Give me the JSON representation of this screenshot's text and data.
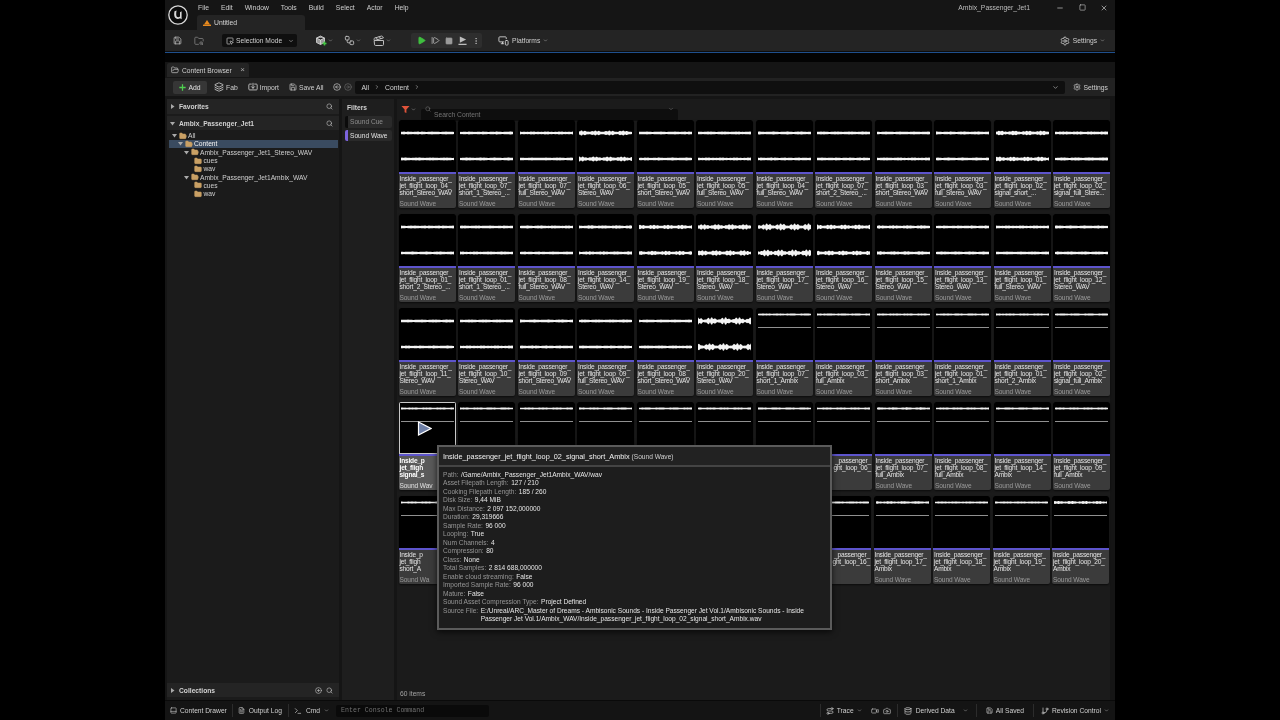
{
  "window": {
    "title": "Ambix_Passenger_Jet1",
    "document_tab": "Untitled"
  },
  "menu": [
    "File",
    "Edit",
    "Window",
    "Tools",
    "Build",
    "Select",
    "Actor",
    "Help"
  ],
  "toolbar": {
    "mode": "Selection Mode",
    "platforms": "Platforms",
    "settings": "Settings"
  },
  "content_browser": {
    "tab": {
      "label": "Content Browser",
      "close": "×"
    },
    "actions": {
      "add": "Add",
      "fab": "Fab",
      "import": "Import",
      "save_all": "Save All"
    },
    "breadcrumb": [
      "All",
      "Content"
    ],
    "settings": "Settings"
  },
  "sources": {
    "favorites": {
      "title": "Favorites",
      "expanded": false
    },
    "project": {
      "title": "Ambix_Passenger_Jet1",
      "expanded": true
    },
    "tree": [
      {
        "label": "All",
        "expanded": true,
        "selected": false,
        "children": [
          {
            "label": "Content",
            "expanded": true,
            "selected": true,
            "children": [
              {
                "label": "Ambix_Passenger_Jet1_Stereo_WAV",
                "expanded": true,
                "selected": false,
                "children": [
                  {
                    "label": "cues",
                    "selected": false
                  },
                  {
                    "label": "wav",
                    "selected": false
                  }
                ]
              },
              {
                "label": "Ambix_Passenger_Jet1Ambix_WAV",
                "expanded": true,
                "selected": false,
                "children": [
                  {
                    "label": "cues",
                    "selected": false
                  },
                  {
                    "label": "wav",
                    "selected": false
                  }
                ]
              }
            ]
          }
        ]
      }
    ],
    "collections": {
      "title": "Collections",
      "expanded": false
    }
  },
  "filters": {
    "title": "Filters",
    "items": [
      {
        "label": "Sound Cue",
        "checked": false
      },
      {
        "label": "Sound Wave",
        "checked": true
      }
    ]
  },
  "search": {
    "placeholder": "Search Content"
  },
  "asset_rows": [
    {
      "tiles": [
        {
          "kind": "stereo",
          "hovered": false,
          "name_lines": [
            "Inside_passenger_",
            "jet_flight_loop_04_",
            "short_Stereo_WAV"
          ],
          "type": "Sound Wave"
        },
        {
          "kind": "stereo",
          "hovered": false,
          "name_lines": [
            "Inside_passenger_",
            "jet_flight_loop_07_",
            "short_1_Stereo_..."
          ],
          "type": "Sound Wave"
        },
        {
          "kind": "stereo",
          "hovered": false,
          "name_lines": [
            "Inside_passenger_",
            "jet_flight_loop_07_",
            "full_Stereo_WAV"
          ],
          "type": "Sound Wave"
        },
        {
          "kind": "stereo",
          "hovered": false,
          "name_lines": [
            "Inside_passenger_",
            "jet_flight_loop_06_",
            "Stereo_WAV"
          ],
          "type": "Sound Wave"
        },
        {
          "kind": "stereo",
          "hovered": false,
          "name_lines": [
            "Inside_passenger_",
            "jet_flight_loop_05_",
            "short_Stereo_WAV"
          ],
          "type": "Sound Wave"
        },
        {
          "kind": "stereo",
          "hovered": false,
          "name_lines": [
            "Inside_passenger_",
            "jet_flight_loop_05_",
            "full_Stereo_WAV"
          ],
          "type": "Sound Wave"
        },
        {
          "kind": "stereo",
          "hovered": false,
          "name_lines": [
            "Inside_passenger_",
            "jet_flight_loop_04_",
            "full_Stereo_WAV"
          ],
          "type": "Sound Wave"
        },
        {
          "kind": "stereo",
          "hovered": false,
          "name_lines": [
            "Inside_passenger_",
            "jet_flight_loop_07_",
            "short_2_Stereo_..."
          ],
          "type": "Sound Wave"
        },
        {
          "kind": "stereo",
          "hovered": false,
          "name_lines": [
            "Inside_passenger_",
            "jet_flight_loop_03_",
            "short_Stereo_WAV"
          ],
          "type": "Sound Wave"
        },
        {
          "kind": "stereo",
          "hovered": false,
          "name_lines": [
            "Inside_passenger_",
            "jet_flight_loop_03_",
            "full_Stereo_WAV"
          ],
          "type": "Sound Wave"
        },
        {
          "kind": "stereo",
          "hovered": false,
          "name_lines": [
            "Inside_passenger_",
            "jet_flight_loop_02_",
            "signal_short_..."
          ],
          "type": "Sound Wave"
        },
        {
          "kind": "stereo",
          "hovered": false,
          "name_lines": [
            "Inside_passenger_",
            "jet_flight_loop_02_",
            "signal_full_Stere..."
          ],
          "type": "Sound Wave"
        }
      ]
    },
    {
      "tiles": [
        {
          "kind": "stereo",
          "hovered": false,
          "name_lines": [
            "Inside_passenger_",
            "jet_flight_loop_01_",
            "short_2_Stereo_..."
          ],
          "type": "Sound Wave"
        },
        {
          "kind": "stereo",
          "hovered": false,
          "name_lines": [
            "Inside_passenger_",
            "jet_flight_loop_01_",
            "short_1_Stereo_..."
          ],
          "type": "Sound Wave"
        },
        {
          "kind": "stereo",
          "hovered": false,
          "name_lines": [
            "Inside_passenger_",
            "jet_flight_loop_08_",
            "full_Stereo_WAV"
          ],
          "type": "Sound Wave"
        },
        {
          "kind": "stereo",
          "hovered": false,
          "name_lines": [
            "Inside_passenger_",
            "jet_flight_loop_14_",
            "Stereo_WAV"
          ],
          "type": "Sound Wave"
        },
        {
          "kind": "stereo",
          "hovered": false,
          "name_lines": [
            "Inside_passenger_",
            "jet_flight_loop_19_",
            "Stereo_WAV"
          ],
          "type": "Sound Wave"
        },
        {
          "kind": "stereo",
          "hovered": false,
          "name_lines": [
            "Inside_passenger_",
            "jet_flight_loop_18_",
            "Stereo_WAV"
          ],
          "type": "Sound Wave"
        },
        {
          "kind": "stereo",
          "hovered": false,
          "name_lines": [
            "Inside_passenger_",
            "jet_flight_loop_17_",
            "Stereo_WAV"
          ],
          "type": "Sound Wave"
        },
        {
          "kind": "stereo",
          "hovered": false,
          "name_lines": [
            "Inside_passenger_",
            "jet_flight_loop_16_",
            "Stereo_WAV"
          ],
          "type": "Sound Wave"
        },
        {
          "kind": "stereo",
          "hovered": false,
          "name_lines": [
            "Inside_passenger_",
            "jet_flight_loop_15_",
            "Stereo_WAV"
          ],
          "type": "Sound Wave"
        },
        {
          "kind": "stereo",
          "hovered": false,
          "name_lines": [
            "Inside_passenger_",
            "jet_flight_loop_13_",
            "Stereo_WAV"
          ],
          "type": "Sound Wave"
        },
        {
          "kind": "stereo",
          "hovered": false,
          "name_lines": [
            "Inside_passenger_",
            "jet_flight_loop_01_",
            "full_Stereo_WAV"
          ],
          "type": "Sound Wave"
        },
        {
          "kind": "stereo",
          "hovered": false,
          "name_lines": [
            "Inside_passenger_",
            "jet_flight_loop_12_",
            "Stereo_WAV"
          ],
          "type": "Sound Wave"
        }
      ]
    },
    {
      "tiles": [
        {
          "kind": "stereo",
          "hovered": false,
          "name_lines": [
            "Inside_passenger_",
            "jet_flight_loop_11_",
            "Stereo_WAV"
          ],
          "type": "Sound Wave"
        },
        {
          "kind": "stereo",
          "hovered": false,
          "name_lines": [
            "Inside_passenger_",
            "jet_flight_loop_10_",
            "Stereo_WAV"
          ],
          "type": "Sound Wave"
        },
        {
          "kind": "stereo",
          "hovered": false,
          "name_lines": [
            "Inside_passenger_",
            "jet_flight_loop_09_",
            "short_Stereo_WAV"
          ],
          "type": "Sound Wave"
        },
        {
          "kind": "stereo",
          "hovered": false,
          "name_lines": [
            "Inside_passenger_",
            "jet_flight_loop_09_",
            "full_Stereo_WAV"
          ],
          "type": "Sound Wave"
        },
        {
          "kind": "stereo",
          "hovered": false,
          "name_lines": [
            "Inside_passenger_",
            "jet_flight_loop_08_",
            "short_Stereo_WAV"
          ],
          "type": "Sound Wave"
        },
        {
          "kind": "stereo",
          "hovered": false,
          "name_lines": [
            "Inside_passenger_",
            "jet_flight_loop_20_",
            "Stereo_WAV"
          ],
          "type": "Sound Wave"
        },
        {
          "kind": "ambix",
          "hovered": false,
          "name_lines": [
            "Inside_passenger_",
            "jet_flight_loop_07_",
            "short_1_Ambix"
          ],
          "type": "Sound Wave"
        },
        {
          "kind": "ambix",
          "hovered": false,
          "name_lines": [
            "Inside_passenger_",
            "jet_flight_loop_03_",
            "full_Ambix"
          ],
          "type": "Sound Wave"
        },
        {
          "kind": "ambix",
          "hovered": false,
          "name_lines": [
            "Inside_passenger_",
            "jet_flight_loop_03_",
            "short_Ambix"
          ],
          "type": "Sound Wave"
        },
        {
          "kind": "ambix",
          "hovered": false,
          "name_lines": [
            "Inside_passenger_",
            "jet_flight_loop_01_",
            "short_1_Ambix"
          ],
          "type": "Sound Wave"
        },
        {
          "kind": "ambix",
          "hovered": false,
          "name_lines": [
            "Inside_passenger_",
            "jet_flight_loop_01_",
            "short_2_Ambix"
          ],
          "type": "Sound Wave"
        },
        {
          "kind": "ambix",
          "hovered": false,
          "name_lines": [
            "Inside_passenger_",
            "jet_flight_loop_02_",
            "signal_full_Ambix"
          ],
          "type": "Sound Wave"
        }
      ]
    },
    {
      "tiles": [
        {
          "kind": "ambix",
          "hovered": true,
          "cut_at_start": false,
          "name_lines": [
            "Inside_p",
            "jet_fligh",
            "signal_s"
          ],
          "type": "Sound Wav"
        },
        {
          "kind": "ambix",
          "hovered": false
        },
        {
          "kind": "ambix",
          "hovered": false
        },
        {
          "kind": "ambix",
          "hovered": false
        },
        {
          "kind": "ambix",
          "hovered": false
        },
        {
          "kind": "ambix",
          "hovered": false
        },
        {
          "kind": "ambix",
          "hovered": false
        },
        {
          "kind": "ambix",
          "hovered": false,
          "cut_at_start": true,
          "name_lines": [
            "_passenger_",
            "ght_loop_06_"
          ]
        },
        {
          "kind": "ambix",
          "hovered": false,
          "name_lines": [
            "Inside_passenger_",
            "jet_flight_loop_07_",
            "full_Ambix"
          ],
          "type": "Sound Wave"
        },
        {
          "kind": "ambix",
          "hovered": false,
          "name_lines": [
            "Inside_passenger_",
            "jet_flight_loop_08_",
            "full_Ambix"
          ],
          "type": "Sound Wave"
        },
        {
          "kind": "ambix",
          "hovered": false,
          "name_lines": [
            "Inside_passenger_",
            "jet_flight_loop_14_",
            "Ambix"
          ],
          "type": "Sound Wave"
        },
        {
          "kind": "ambix",
          "hovered": false,
          "name_lines": [
            "Inside_passenger_",
            "jet_flight_loop_09_",
            "full_Ambix"
          ],
          "type": "Sound Wave"
        }
      ]
    },
    {
      "tiles": [
        {
          "kind": "ambix",
          "hovered": false,
          "cut_at_start": false,
          "name_lines": [
            "Inside_p",
            "jet_fligh",
            "short_A"
          ],
          "type": "Sound Wa"
        }
      ],
      "trailing_tiles": [
        {
          "kind": "ambix",
          "hovered": false,
          "cut_at_start": true,
          "name_lines": [
            "_passenger_",
            "ght_loop_16_"
          ]
        },
        {
          "kind": "ambix",
          "hovered": false,
          "name_lines": [
            "Inside_passenger_",
            "jet_flight_loop_17_",
            "Ambix"
          ],
          "type": "Sound Wave"
        },
        {
          "kind": "ambix",
          "hovered": false,
          "name_lines": [
            "Inside_passenger_",
            "jet_flight_loop_18_",
            "Ambix"
          ],
          "type": "Sound Wave"
        },
        {
          "kind": "ambix",
          "hovered": false,
          "name_lines": [
            "Inside_passenger_",
            "jet_flight_loop_19_",
            "Ambix"
          ],
          "type": "Sound Wave"
        },
        {
          "kind": "ambix",
          "hovered": false,
          "name_lines": [
            "Inside_passenger_",
            "jet_flight_loop_20_",
            "Ambix"
          ],
          "type": "Sound Wave"
        }
      ]
    }
  ],
  "item_count": "60 items",
  "tooltip": {
    "title": "Inside_passenger_jet_flight_loop_02_signal_short_Ambix",
    "type": "(Sound Wave)",
    "properties": [
      {
        "label": "Path:",
        "value": "/Game/Ambix_Passenger_Jet1Ambix_WAV/wav"
      },
      {
        "label": "Asset Filepath Length:",
        "value": "127 / 210"
      },
      {
        "label": "Cooking Filepath Length:",
        "value": "185 / 260"
      },
      {
        "label": "Disk Size:",
        "value": "9,44 MiB"
      },
      {
        "label": "Max Distance:",
        "value": "2 097 152,000000"
      },
      {
        "label": "Duration:",
        "value": "29,319666"
      },
      {
        "label": "Sample Rate:",
        "value": "96 000"
      },
      {
        "label": "Looping:",
        "value": "True"
      },
      {
        "label": "Num Channels:",
        "value": "4"
      },
      {
        "label": "Compression:",
        "value": "80"
      },
      {
        "label": "Class:",
        "value": "None"
      },
      {
        "label": "Total Samples:",
        "value": "2 814 688,000000"
      },
      {
        "label": "Enable cloud streaming:",
        "value": "False"
      },
      {
        "label": "Imported Sample Rate:",
        "value": "96 000"
      },
      {
        "label": "Mature:",
        "value": "False"
      },
      {
        "label": "Sound Asset Compression Type:",
        "value": "Project Defined"
      },
      {
        "label": "Source File:",
        "value": "E:/Unreal/ARC_Master of Dreams - Ambisonic Sounds - Inside Passenger Jet Vol.1/Ambisonic Sounds - Inside Passenger Jet Vol.1/Ambix_WAV/Inside_passenger_jet_flight_loop_02_signal_short_Ambix.wav"
      }
    ]
  },
  "status_bar": {
    "content_drawer": "Content Drawer",
    "output_log": "Output Log",
    "cmd": "Cmd",
    "console_placeholder": "Enter Console Command",
    "trace": "Trace",
    "derived_data": "Derived Data",
    "save_state": "All Saved",
    "revision_control": "Revision Control"
  }
}
